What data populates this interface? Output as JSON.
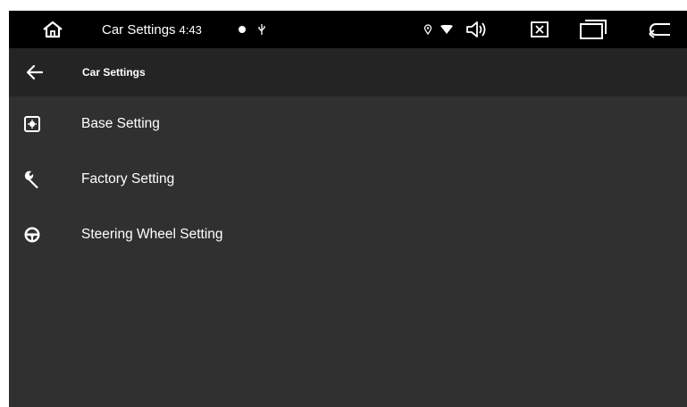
{
  "status_bar": {
    "title": "Car Settings",
    "time": "4:43",
    "icons": [
      "home-icon",
      "notification-dot-icon",
      "usb-icon",
      "location-icon",
      "wifi-icon",
      "volume-icon",
      "close-app-icon",
      "recent-apps-icon",
      "back-nav-icon"
    ]
  },
  "app_bar": {
    "title": "Car Settings",
    "back_icon": "arrow-left-icon"
  },
  "settings": {
    "items": [
      {
        "label": "Base Setting",
        "icon": "base-setting-icon"
      },
      {
        "label": "Factory Setting",
        "icon": "wrench-icon"
      },
      {
        "label": "Steering Wheel Setting",
        "icon": "steering-wheel-icon"
      }
    ]
  },
  "colors": {
    "status_bar_bg": "#000000",
    "app_bar_bg": "#242424",
    "content_bg": "#303030",
    "text": "#ffffff"
  }
}
